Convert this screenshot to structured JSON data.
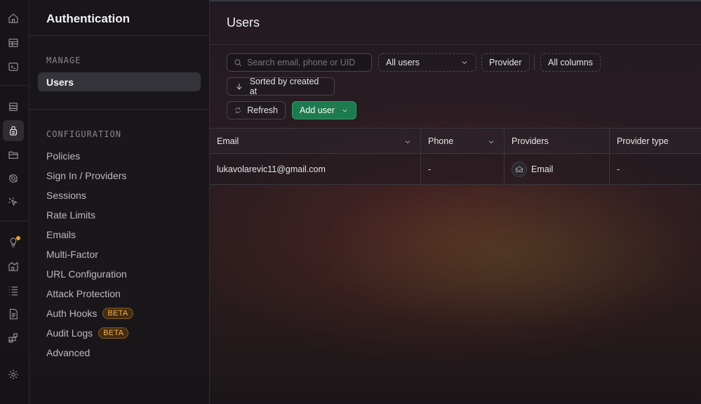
{
  "rail": {
    "icons": [
      "home-icon",
      "table-editor-icon",
      "sql-editor-icon",
      "database-icon",
      "authentication-icon",
      "storage-icon",
      "realtime-icon",
      "edge-functions-icon",
      "advisors-icon",
      "reports-icon",
      "logs-icon",
      "api-docs-icon",
      "integrations-icon",
      "settings-icon"
    ],
    "active": "authentication-icon",
    "notification_color": "#f0a030"
  },
  "sidebar": {
    "title": "Authentication",
    "manage_label": "MANAGE",
    "manage_items": [
      {
        "label": "Users"
      }
    ],
    "configuration_label": "CONFIGURATION",
    "config_items": [
      {
        "label": "Policies"
      },
      {
        "label": "Sign In / Providers"
      },
      {
        "label": "Sessions"
      },
      {
        "label": "Rate Limits"
      },
      {
        "label": "Emails"
      },
      {
        "label": "Multi-Factor"
      },
      {
        "label": "URL Configuration"
      },
      {
        "label": "Attack Protection"
      },
      {
        "label": "Auth Hooks",
        "badge": "BETA"
      },
      {
        "label": "Audit Logs",
        "badge": "BETA"
      },
      {
        "label": "Advanced"
      }
    ]
  },
  "main": {
    "title": "Users",
    "search_placeholder": "Search email, phone or UID",
    "filter_label": "All users",
    "provider_label": "Provider",
    "columns_label": "All columns",
    "sort_label": "Sorted by created at",
    "refresh_label": "Refresh",
    "add_user_label": "Add user",
    "accent_color": "#1e7a4f"
  },
  "table": {
    "headers": [
      "Email",
      "Phone",
      "Providers",
      "Provider type"
    ],
    "rows": [
      {
        "email": "lukavolarevic11@gmail.com",
        "phone": "-",
        "provider": "Email",
        "provider_type": "-"
      }
    ]
  }
}
